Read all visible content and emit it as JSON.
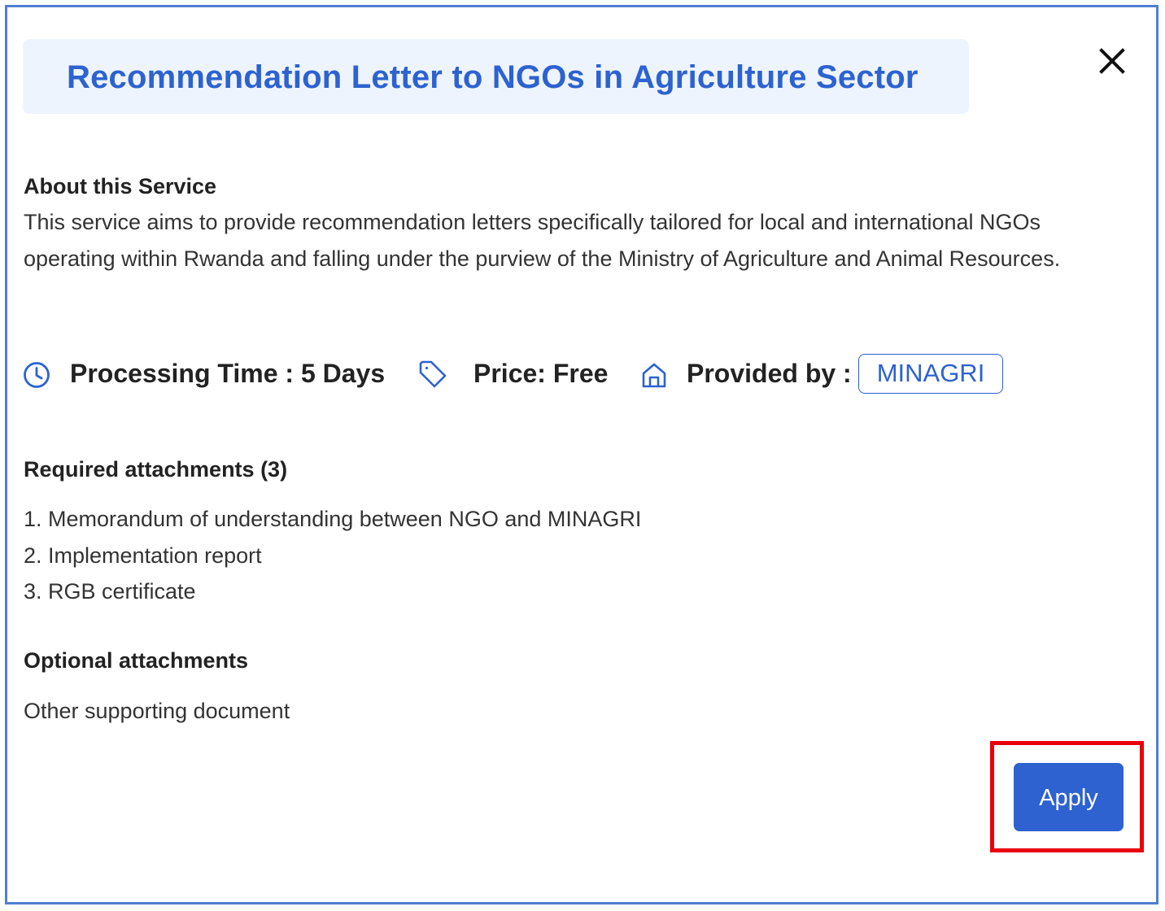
{
  "dialog": {
    "title": "Recommendation Letter to NGOs in Agriculture Sector",
    "close_icon": "close-icon"
  },
  "about": {
    "heading": "About this Service",
    "description": "This service aims to provide recommendation letters specifically tailored for local and international NGOs operating within Rwanda and falling under the purview of the Ministry of Agriculture and Animal Resources."
  },
  "meta": {
    "processing_time": "Processing Time : 5 Days",
    "price": "Price: Free",
    "provided_by_label": "Provided by :",
    "provider": "MINAGRI",
    "icons": [
      "clock-icon",
      "price-tag-icon",
      "home-icon"
    ]
  },
  "required": {
    "heading": "Required attachments (3)",
    "items": [
      "1. Memorandum of understanding between NGO and MINAGRI",
      "2. Implementation report",
      "3. RGB certificate"
    ]
  },
  "optional": {
    "heading": "Optional attachments",
    "items": [
      "Other supporting document"
    ]
  },
  "actions": {
    "apply_label": "Apply"
  },
  "colors": {
    "accent": "#2d62d0",
    "title_background": "#eef4fd",
    "frame_border": "#4f7fd1",
    "highlight": "#e8000b"
  }
}
